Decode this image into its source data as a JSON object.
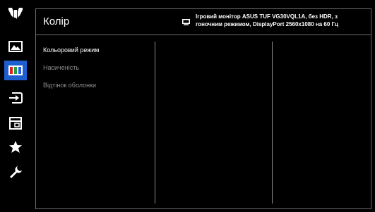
{
  "rail": {
    "items": [
      {
        "icon": "tuf-logo-icon",
        "active": false
      },
      {
        "icon": "image-icon",
        "active": false
      },
      {
        "icon": "color-bars-icon",
        "active": true
      },
      {
        "icon": "input-select-icon",
        "active": false
      },
      {
        "icon": "system-setup-icon",
        "active": false
      },
      {
        "icon": "favorite-star-icon",
        "active": false
      },
      {
        "icon": "wrench-icon",
        "active": false
      }
    ],
    "active_color": "#1e5fd0"
  },
  "header": {
    "title": "Колір",
    "model_line1": "Ігровий монітор ASUS TUF VG30VQL1A, без HDR, з",
    "model_line2": "гоночним режимом, DisplayPort 2560x1080 на 60 Гц"
  },
  "menu": {
    "items": [
      {
        "label": "Кольоровий режим",
        "state": "selected"
      },
      {
        "label": "Насиченість",
        "state": "disabled"
      },
      {
        "label": "Відтінок оболонки",
        "state": "disabled"
      }
    ]
  }
}
